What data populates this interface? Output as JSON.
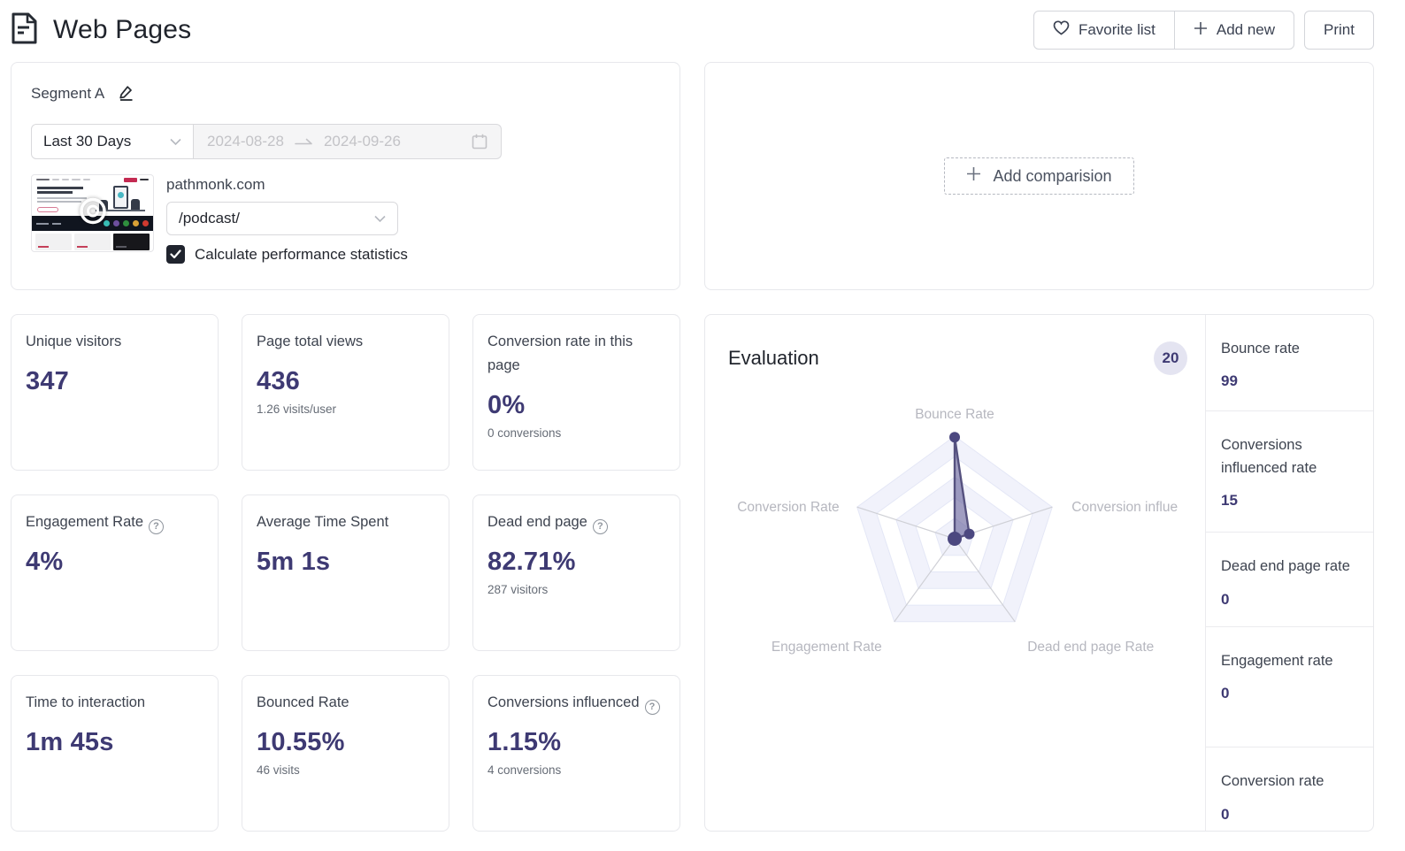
{
  "page": {
    "title": "Web Pages"
  },
  "header": {
    "favorite_button": "Favorite list",
    "add_new_button": "Add new",
    "print_button": "Print"
  },
  "segment": {
    "name": "Segment A",
    "preset": "Last 30 Days",
    "date_start": "2024-08-28",
    "date_end": "2024-09-26",
    "site": "pathmonk.com",
    "page_select": "/podcast/",
    "calc_label": "Calculate performance statistics",
    "calc_checked": true
  },
  "comparison": {
    "label": "Add comparision"
  },
  "metrics": [
    {
      "label": "Unique visitors",
      "value": "347",
      "sub": ""
    },
    {
      "label": "Page total views",
      "value": "436",
      "sub": "1.26 visits/user"
    },
    {
      "label": "Conversion rate in this page",
      "value": "0%",
      "sub": "0 conversions"
    },
    {
      "label": "Engagement Rate",
      "value": "4%",
      "sub": ""
    },
    {
      "label": "Average Time Spent",
      "value": "5m 1s",
      "sub": ""
    },
    {
      "label": "Dead end page",
      "value": "82.71%",
      "sub": "287 visitors"
    },
    {
      "label": "Time to interaction",
      "value": "1m 45s",
      "sub": ""
    },
    {
      "label": "Bounced Rate",
      "value": "10.55%",
      "sub": "46 visits"
    },
    {
      "label": "Conversions influenced",
      "value": "1.15%",
      "sub": "4 conversions"
    }
  ],
  "evaluation": {
    "title": "Evaluation",
    "score": "20",
    "stats": [
      {
        "label": "Bounce rate",
        "value": "99"
      },
      {
        "label": "Conversions influenced rate",
        "value": "15"
      },
      {
        "label": "Dead end page rate",
        "value": "0"
      },
      {
        "label": "Engagement rate",
        "value": "0"
      },
      {
        "label": "Conversion rate",
        "value": "0"
      }
    ]
  },
  "chart_data": {
    "type": "radar",
    "axes": [
      "Bounce Rate",
      "Conversion influence rate",
      "Dead end page Rate",
      "Engagement Rate",
      "Conversion Rate"
    ],
    "axis_display": [
      "Bounce Rate",
      "Conversion influe",
      "Dead end page Rate",
      "Engagement Rate",
      "Conversion Rate"
    ],
    "values": [
      99,
      15,
      0,
      0,
      0
    ],
    "max": 100,
    "rings": 5,
    "legend": "none",
    "colors": {
      "ring_alt": "#f1f2fb",
      "ring_line": "#e4e7f6",
      "spoke": "#cfd0d6",
      "area_fill": "rgba(96,92,152,0.60)",
      "area_line": "#55517f",
      "dot": "#4c4880",
      "label": "#b6b7bf"
    }
  },
  "colors": {
    "accent": "#3e3a73",
    "border": "#e7e8ec",
    "muted": "#666c76"
  }
}
